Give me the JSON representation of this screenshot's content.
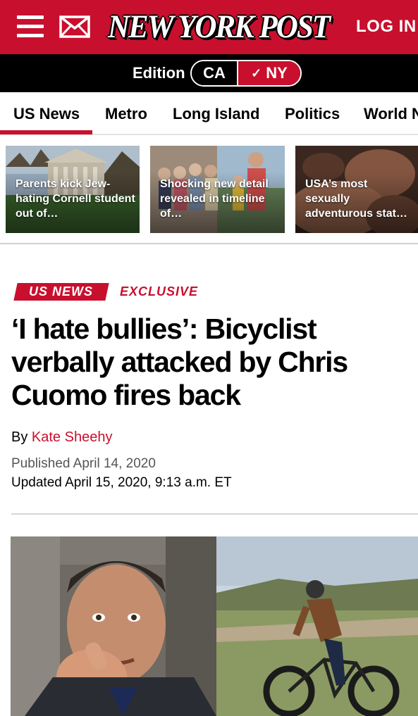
{
  "header": {
    "logo_text": "NEW YORK POST",
    "login_label": "LOG IN",
    "menu_icon": "hamburger-menu-icon",
    "mail_icon": "envelope-icon",
    "brand_color": "#c8102e"
  },
  "edition": {
    "label": "Edition",
    "options": [
      "CA",
      "NY"
    ],
    "selected": "NY",
    "selected_icon": "checkmark-icon"
  },
  "sections": {
    "active": "US News",
    "items": [
      "US News",
      "Metro",
      "Long Island",
      "Politics",
      "World News"
    ]
  },
  "trending": [
    {
      "caption": "Parents kick Jew-hating Cornell student out of…"
    },
    {
      "caption": "Shocking new detail revealed in timeline of…"
    },
    {
      "caption": "USA’s most sexually adventurous stat…"
    }
  ],
  "article": {
    "section_tag": "US NEWS",
    "label": "EXCLUSIVE",
    "headline": "‘I hate bullies’: Bicyclist verbally attacked by Chris Cuomo fires back",
    "byline_prefix": "By",
    "author": "Kate Sheehy",
    "published": "Published April 14, 2020",
    "updated": "Updated April 15, 2020, 9:13 a.m. ET"
  }
}
